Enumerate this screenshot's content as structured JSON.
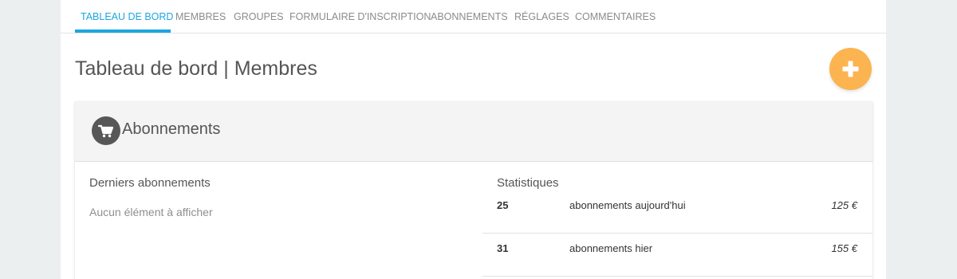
{
  "nav": {
    "tabs": [
      {
        "label": "TABLEAU DE BORD",
        "active": true
      },
      {
        "label": "MEMBRES",
        "active": false
      },
      {
        "label": "GROUPES",
        "active": false
      },
      {
        "label": "FORMULAIRE D'INSCRIPTION",
        "active": false
      },
      {
        "label": "ABONNEMENTS",
        "active": false
      },
      {
        "label": "RÉGLAGES",
        "active": false
      },
      {
        "label": "COMMENTAIRES",
        "active": false
      }
    ]
  },
  "header": {
    "title": "Tableau de bord | Membres",
    "add_button_icon": "plus-icon"
  },
  "card": {
    "icon": "cart-icon",
    "title": "Abonnements",
    "recent": {
      "title": "Derniers abonnements",
      "empty_text": "Aucun élément à afficher"
    },
    "stats": {
      "title": "Statistiques",
      "rows": [
        {
          "count": "25",
          "label": "abonnements aujourd'hui",
          "amount": "125 €"
        },
        {
          "count": "31",
          "label": "abonnements hier",
          "amount": "155 €"
        }
      ]
    }
  },
  "colors": {
    "accent": "#1ca6e0",
    "add_button": "#fbb450",
    "background": "#eceff0"
  }
}
